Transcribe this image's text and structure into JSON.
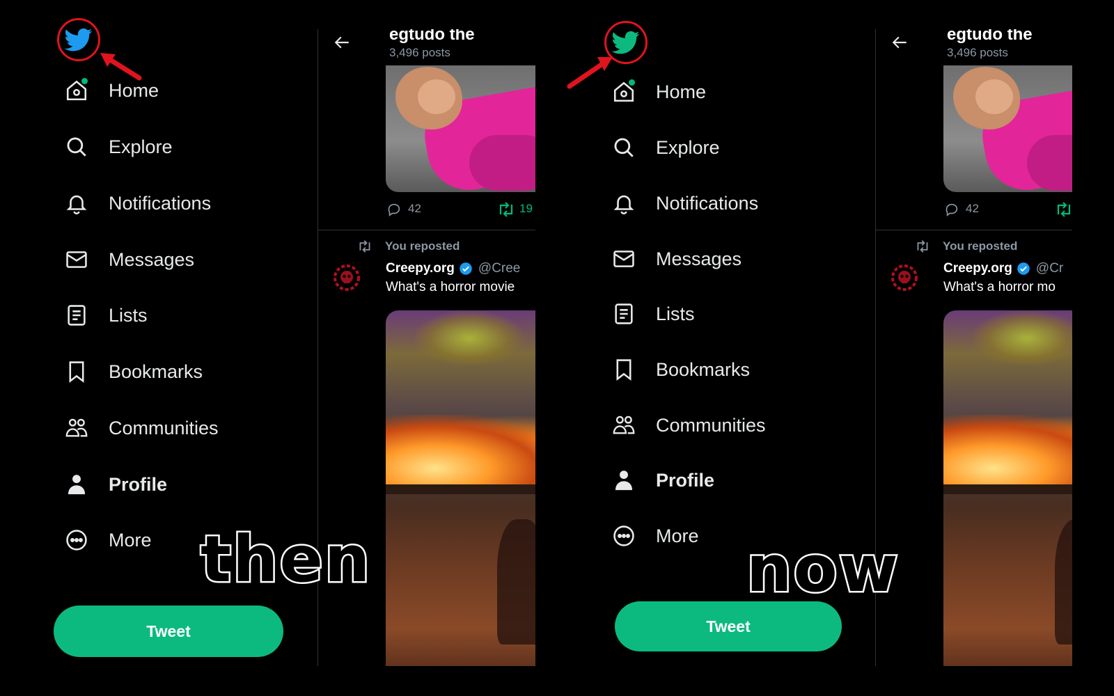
{
  "colors": {
    "background": "#000000",
    "then_logo": "#1d9bf0",
    "now_logo": "#0cba80",
    "tweet_button": "#0cba80",
    "annotation_red": "#e0141c",
    "notification_dot": "#00ba7c"
  },
  "panels": [
    {
      "id": "then",
      "logo_icon": "twitter-bird-icon",
      "nav": [
        {
          "icon": "home-icon",
          "label": "Home"
        },
        {
          "icon": "search-icon",
          "label": "Explore"
        },
        {
          "icon": "bell-icon",
          "label": "Notifications"
        },
        {
          "icon": "mail-icon",
          "label": "Messages"
        },
        {
          "icon": "list-icon",
          "label": "Lists"
        },
        {
          "icon": "bookmark-icon",
          "label": "Bookmarks"
        },
        {
          "icon": "people-icon",
          "label": "Communities"
        },
        {
          "icon": "person-icon",
          "label": "Profile"
        },
        {
          "icon": "more-circle-icon",
          "label": "More"
        }
      ],
      "tweet_button": "Tweet",
      "overlay": "then",
      "feed": {
        "header_title": "egtudo the",
        "header_sub": "3,496 posts",
        "reply_count": "42",
        "retweet_count": "19",
        "repost_text": "You reposted",
        "author_name": "Creepy.org",
        "author_handle": "@Cree",
        "tweet_text": "What's a horror movie"
      }
    },
    {
      "id": "now",
      "logo_icon": "twitter-bird-icon",
      "nav": [
        {
          "icon": "home-icon",
          "label": "Home"
        },
        {
          "icon": "search-icon",
          "label": "Explore"
        },
        {
          "icon": "bell-icon",
          "label": "Notifications"
        },
        {
          "icon": "mail-icon",
          "label": "Messages"
        },
        {
          "icon": "list-icon",
          "label": "Lists"
        },
        {
          "icon": "bookmark-icon",
          "label": "Bookmarks"
        },
        {
          "icon": "people-icon",
          "label": "Communities"
        },
        {
          "icon": "person-icon",
          "label": "Profile"
        },
        {
          "icon": "more-circle-icon",
          "label": "More"
        }
      ],
      "tweet_button": "Tweet",
      "overlay": "now",
      "feed": {
        "header_title": "egtudo the",
        "header_sub": "3,496 posts",
        "reply_count": "42",
        "retweet_count": "",
        "repost_text": "You reposted",
        "author_name": "Creepy.org",
        "author_handle": "@Cr",
        "tweet_text": "What's a horror mo"
      }
    }
  ]
}
